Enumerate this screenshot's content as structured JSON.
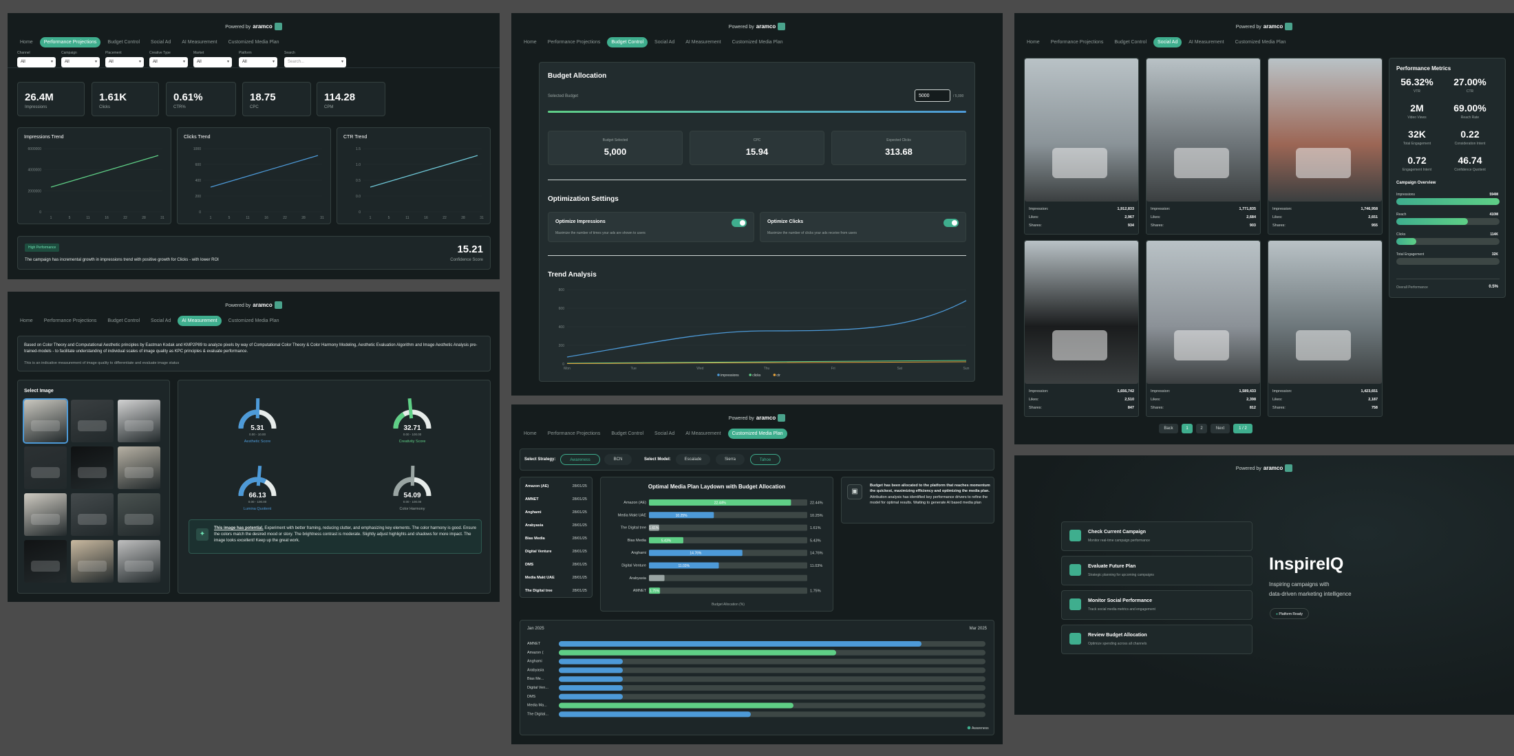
{
  "powered_by": "Powered by",
  "brand": "aramco",
  "tabs": [
    "Home",
    "Performance Projections",
    "Budget Control",
    "Social Ad",
    "AI Measurement",
    "Customized Media Plan"
  ],
  "perf": {
    "filters": [
      {
        "label": "Channel",
        "value": "All"
      },
      {
        "label": "Campaign",
        "value": "All"
      },
      {
        "label": "Placement",
        "value": "All"
      },
      {
        "label": "Creative Type",
        "value": "All"
      },
      {
        "label": "Market",
        "value": "All"
      },
      {
        "label": "Platform",
        "value": "All"
      }
    ],
    "search_label": "Search",
    "search_placeholder": "Search...",
    "kpis": [
      {
        "value": "26.4M",
        "label": "Impressions"
      },
      {
        "value": "1.61K",
        "label": "Clicks"
      },
      {
        "value": "0.61%",
        "label": "CTR%"
      },
      {
        "value": "18.75",
        "label": "CPC"
      },
      {
        "value": "114.28",
        "label": "CPM"
      }
    ],
    "charts": [
      {
        "title": "Impressions Trend",
        "yticks": [
          "6000000",
          "4000000",
          "2000000",
          "0"
        ],
        "xticks": [
          "1",
          "5",
          "11",
          "16",
          "22",
          "28",
          "31"
        ],
        "color": "#5fcf86"
      },
      {
        "title": "Clicks Trend",
        "yticks": [
          "1000",
          "600",
          "400",
          "200",
          "0"
        ],
        "xticks": [
          "1",
          "5",
          "11",
          "16",
          "22",
          "28",
          "31"
        ],
        "color": "#4d9ad8"
      },
      {
        "title": "CTR Trend",
        "yticks": [
          "1.5",
          "1.0",
          "0.5",
          "0.0",
          "0"
        ],
        "xticks": [
          "1",
          "5",
          "11",
          "16",
          "22",
          "28",
          "31"
        ],
        "color": "#6fc8d8"
      }
    ],
    "badge": "High Performance",
    "insight": "The campaign has incremental growth in impressions trend with positive growth for Clicks - with lower ROI",
    "score": "15.21",
    "score_label": "Confidence Score"
  },
  "ai": {
    "intro_html_text": "Based on Color Theory and Computational Aesthetic principles by Eastman Kodak and KMP2P89 to analyze pixels by way of Computational Color Theory & Color Harmony Modeling, Aesthetic Evaluation Algorithm and Image Aesthetic Analysis pre-trained-models - to facilitate understanding of individual scales of image quality as KPC principles & evaluate performance.",
    "intro_sub": "This is an indicative measurement of image quality to differentiate and evaluate image status",
    "select_title": "Select Image",
    "gauges": [
      {
        "value": "5.31",
        "range": "0.00 - 10.00",
        "label": "Aesthetic Score",
        "color": "#4d9ad8",
        "level": 0.53
      },
      {
        "value": "32.71",
        "range": "0.00 - 100.00",
        "label": "Creativity Score",
        "color": "#5fcf86",
        "level": 0.33
      },
      {
        "value": "66.13",
        "range": "0.00 - 100.00",
        "label": "Lumina Quotient",
        "color": "#4d9ad8",
        "level": 0.66
      },
      {
        "value": "54.09",
        "range": "0.00 - 100.00",
        "label": "Color Harmony",
        "color": "#9aa5a3",
        "level": 0.54
      }
    ],
    "result_bold": "This image has potential.",
    "result_text": " Experiment with better framing, reducing clutter, and emphasizing key elements. The color harmony is good. Ensure the colors match the desired mood or story. The brightness contrast is moderate. Slightly adjust highlights and shadows for more impact. The image looks excellent! Keep up the great work."
  },
  "budget": {
    "title": "Budget Allocation",
    "selected_label": "Selected Budget",
    "input_value": "5000",
    "input_max": "/ 5,000",
    "progress": 1.0,
    "boxes": [
      {
        "label": "Budget Selected",
        "value": "5,000"
      },
      {
        "label": "CPC",
        "value": "15.94"
      },
      {
        "label": "Expected Clicks",
        "value": "313.68"
      }
    ],
    "opt_title": "Optimization Settings",
    "opts": [
      {
        "title": "Optimize Impressions",
        "desc": "Maximize the number of times your ads are shown to users"
      },
      {
        "title": "Optimize Clicks",
        "desc": "Maximize the number of clicks your ads receive from users"
      }
    ],
    "trend_title": "Trend Analysis",
    "trend_yticks": [
      "800",
      "600",
      "400",
      "200",
      "0"
    ],
    "trend_x": [
      "Mon",
      "Tue",
      "Wed",
      "Thu",
      "Fri",
      "Sat",
      "Sun"
    ],
    "legend": [
      "impressions",
      "clicks",
      "ctr"
    ],
    "colors": {
      "impressions": "#4d9ad8",
      "clicks": "#5fcf86",
      "ctr": "#e8a33b"
    }
  },
  "social": {
    "posts": [
      {
        "impression": "1,912,833",
        "likes": "2,967",
        "shares": "934"
      },
      {
        "impression": "1,771,835",
        "likes": "2,684",
        "shares": "903"
      },
      {
        "impression": "1,746,958",
        "likes": "2,651",
        "shares": "955"
      },
      {
        "impression": "1,656,742",
        "likes": "2,510",
        "shares": "847"
      },
      {
        "impression": "1,589,433",
        "likes": "2,398",
        "shares": "812"
      },
      {
        "impression": "1,423,651",
        "likes": "2,187",
        "shares": "758"
      }
    ],
    "row_labels": [
      "Impression:",
      "Likes:",
      "Shares:"
    ],
    "pager": [
      "Back",
      "1",
      "2",
      "Next",
      "1 / 2"
    ],
    "metrics_title": "Performance Metrics",
    "metrics": [
      {
        "value": "56.32%",
        "label": "VTR"
      },
      {
        "value": "27.00%",
        "label": "CTR"
      },
      {
        "value": "2M",
        "label": "Video Views"
      },
      {
        "value": "69.00%",
        "label": "Reach Rate"
      },
      {
        "value": "32K",
        "label": "Total Engagement"
      },
      {
        "value": "0.22",
        "label": "Consideration Intent"
      },
      {
        "value": "0.72",
        "label": "Engagement Intent"
      },
      {
        "value": "46.74",
        "label": "Confidence Quotient"
      }
    ],
    "overview_title": "Campaign Overview",
    "overview": [
      {
        "label": "Impressions",
        "value": "594M",
        "level": 1.0,
        "color": "#3fae8e"
      },
      {
        "label": "Reach",
        "value": "410M",
        "level": 0.69,
        "color": "#3fae8e"
      },
      {
        "label": "Clicks",
        "value": "114K",
        "level": 0.19,
        "color": "#3fae8e"
      },
      {
        "label": "Total Engagement",
        "value": "32K",
        "level": 0.0,
        "color": "#3fae8e"
      }
    ],
    "overall_label": "Overall Performance",
    "overall_value": "0.5%"
  },
  "media": {
    "strategy_label": "Select Strategy:",
    "strategies": [
      "Awareness",
      "BCN"
    ],
    "model_label": "Select Model:",
    "models": [
      "Escalade",
      "Sierra",
      "Tahoe"
    ],
    "list": [
      {
        "name": "Amazon (AE)",
        "date": "28/01/25"
      },
      {
        "name": "AMNET",
        "date": "28/01/25"
      },
      {
        "name": "Anghami",
        "date": "28/01/25"
      },
      {
        "name": "Arabyasia",
        "date": "28/01/25"
      },
      {
        "name": "Bias Media",
        "date": "28/01/25"
      },
      {
        "name": "Digital Venture",
        "date": "28/01/25"
      },
      {
        "name": "DMS",
        "date": "28/01/25"
      },
      {
        "name": "Media Makt UAE",
        "date": "28/01/25"
      },
      {
        "name": "The Digital tree",
        "date": "28/01/25"
      }
    ],
    "chart_title": "Optimal Media Plan Laydown with Budget Allocation",
    "chart_xlabel": "Budget Allocation (%)",
    "info_bold": "Budget has been allocated to the platform that reaches momentum the quickest, maximizing efficiency and optimizing the media plan.",
    "info_text": " Attribution analysis has identified key performance drivers to refine the model for optimal results. Waiting to generate AI based media plan",
    "gantt_start": "Jan 2025",
    "gantt_end": "Mar 2025",
    "gantt_rows": [
      "AMNET",
      "Amazon (",
      "Anghami",
      "Arabyasia",
      "Bias Me...",
      "Digital Ven...",
      "DMS",
      "Media Ma...",
      "The Digital..."
    ],
    "gantt_legend": "Awareness"
  },
  "chart_data": [
    {
      "type": "bar",
      "title": "Optimal Media Plan Laydown with Budget Allocation",
      "xlabel": "Budget Allocation (%)",
      "categories": [
        "Amazon (AE)",
        "Media Makt UAE",
        "The Digital tree",
        "Bias Media",
        "Anghami",
        "Digital Venture",
        "Arabyasia",
        "AMNET"
      ],
      "values": [
        22.44,
        10.25,
        1.61,
        5.43,
        14.76,
        11.03,
        2.45,
        1.75
      ],
      "labels": [
        "22.44%",
        "10.25%",
        "1.61%",
        "5.43%",
        "14.76%",
        "11.03%",
        "",
        "1.75%"
      ],
      "colors": [
        "#5fcf86",
        "#4d9ad8",
        "#9aa5a3",
        "#5fcf86",
        "#4d9ad8",
        "#4d9ad8",
        "#9aa5a3",
        "#5fcf86"
      ]
    },
    {
      "type": "bar",
      "title": "",
      "categories": [
        "AMNET",
        "Amazon (",
        "Anghami",
        "Arabyasia",
        "Bias Me...",
        "Digital Ven...",
        "DMS",
        "Media Ma...",
        "The Digital..."
      ],
      "values": [
        0.85,
        0.65,
        0.15,
        0.15,
        0.15,
        0.15,
        0.15,
        0.55,
        0.45
      ],
      "colors": [
        "#4d9ad8",
        "#5fcf86",
        "#4d9ad8",
        "#4d9ad8",
        "#4d9ad8",
        "#4d9ad8",
        "#4d9ad8",
        "#5fcf86",
        "#4d9ad8"
      ]
    }
  ],
  "landing": {
    "items": [
      {
        "title": "Check Current Campaign",
        "desc": "Monitor real-time campaign performance"
      },
      {
        "title": "Evaluate Future Plan",
        "desc": "Strategic planning for upcoming campaigns"
      },
      {
        "title": "Monitor Social Performance",
        "desc": "Track social media metrics and engagement"
      },
      {
        "title": "Review Budget Allocation",
        "desc": "Optimize spending across all channels"
      }
    ],
    "brand_title": "InspireIQ",
    "tagline1": "Inspiring campaigns with",
    "tagline2": "data-driven marketing intelligence",
    "badge": "Platform Ready"
  }
}
